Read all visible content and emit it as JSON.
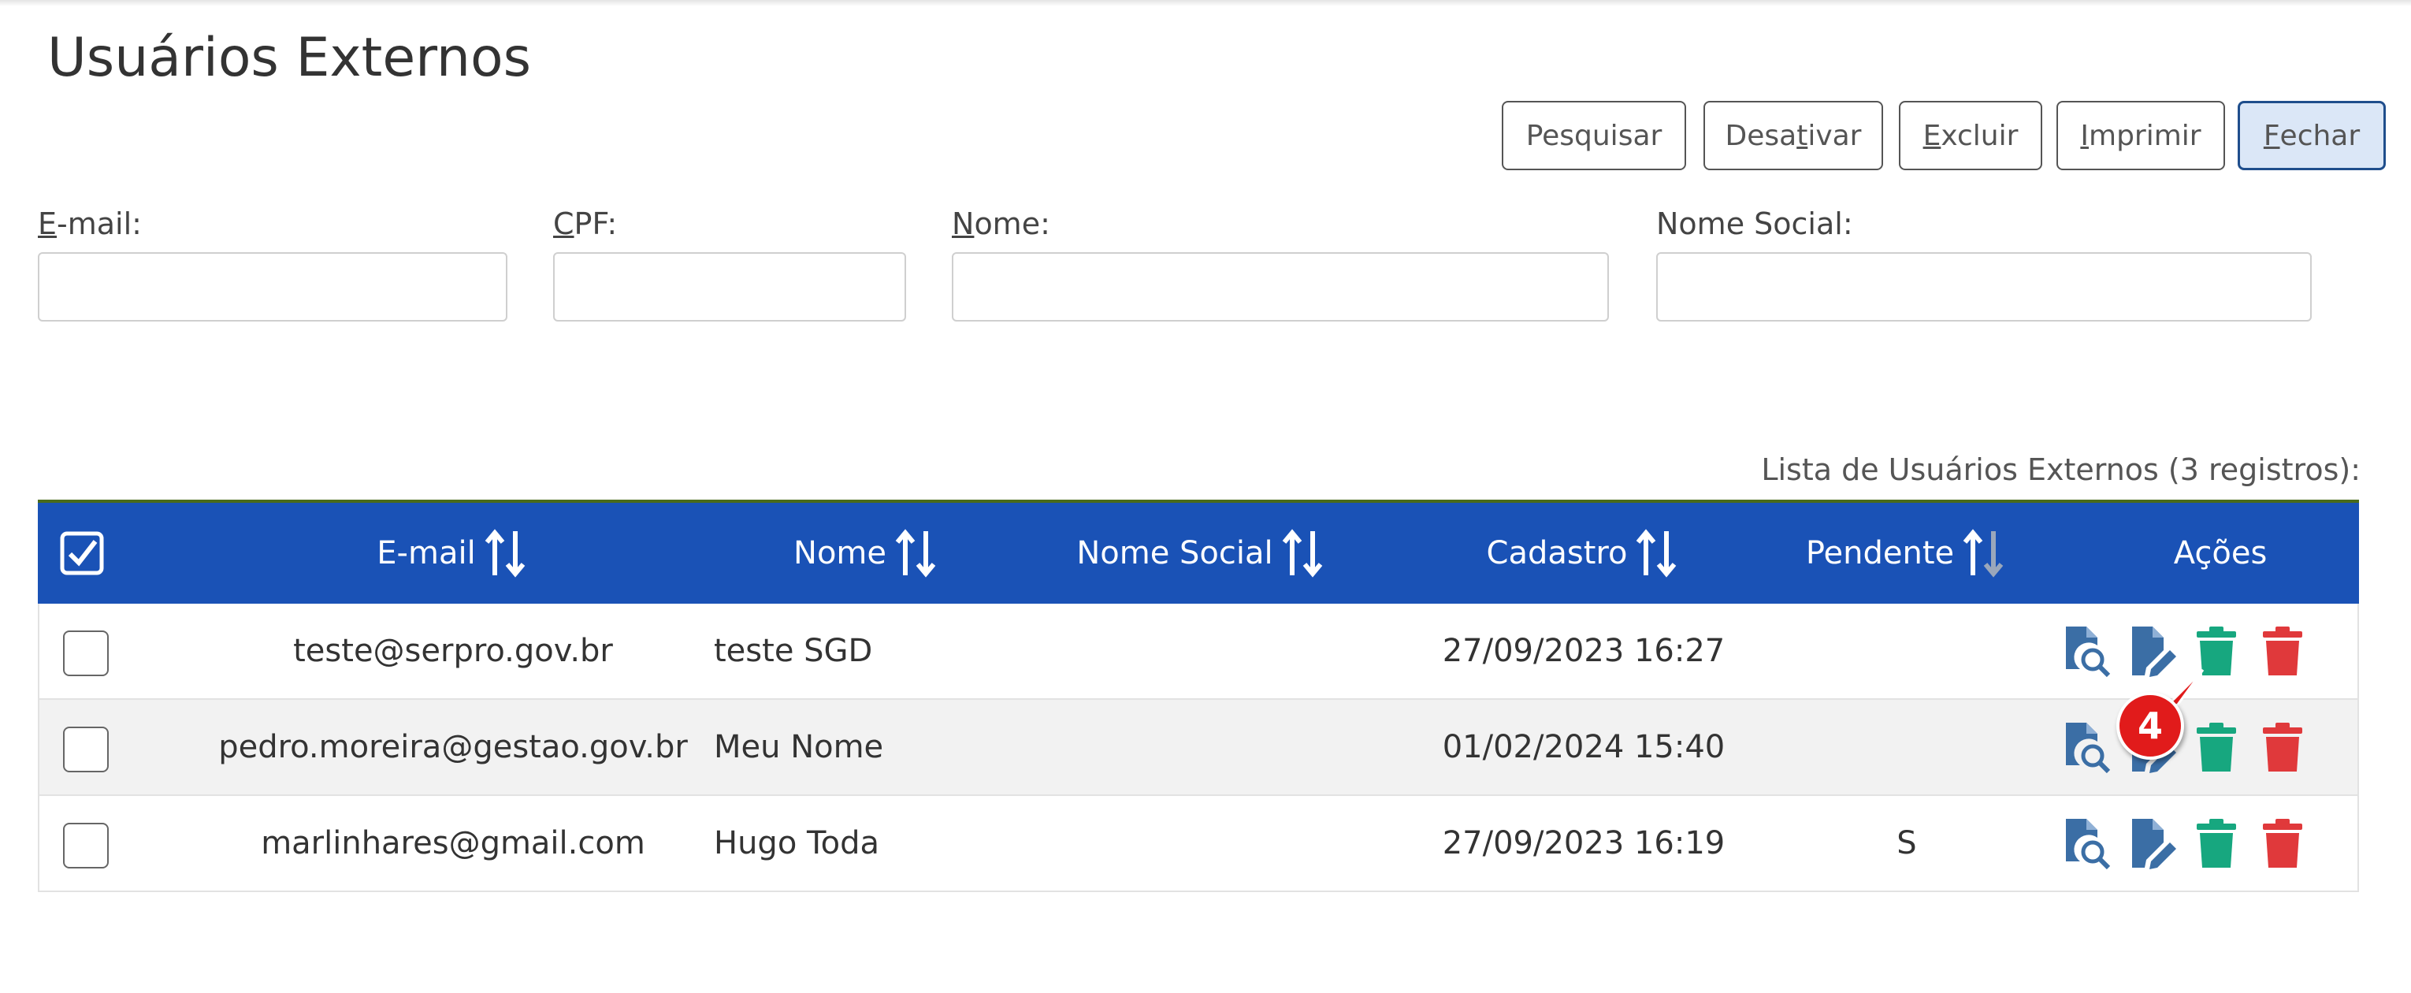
{
  "page": {
    "title": "Usuários Externos"
  },
  "toolbar": {
    "pesquisar": {
      "pre": "Pesquisar",
      "key": "",
      "post": ""
    },
    "desativar": {
      "pre": "Desa",
      "key": "t",
      "post": "ivar"
    },
    "excluir": {
      "pre": "",
      "key": "E",
      "post": "xcluir"
    },
    "imprimir": {
      "pre": "",
      "key": "I",
      "post": "mprimir"
    },
    "fechar": {
      "pre": "",
      "key": "F",
      "post": "echar"
    }
  },
  "filters": {
    "email": {
      "key": "E",
      "rest": "-mail:",
      "value": ""
    },
    "cpf": {
      "key": "C",
      "rest": "PF:",
      "value": ""
    },
    "nome": {
      "key": "N",
      "rest": "ome:",
      "value": ""
    },
    "nome_social": {
      "label": "Nome Social:",
      "value": ""
    }
  },
  "list": {
    "caption": "Lista de Usuários Externos (3 registros):",
    "columns": {
      "email": "E-mail",
      "nome": "Nome",
      "nome_social": "Nome Social",
      "cadastro": "Cadastro",
      "pendente": "Pendente",
      "acoes": "Ações"
    },
    "rows": [
      {
        "email": "teste@serpro.gov.br",
        "nome": "teste SGD",
        "nome_social": "",
        "cadastro": "27/09/2023 16:27",
        "pendente": ""
      },
      {
        "email": "pedro.moreira@gestao.gov.br",
        "nome": "Meu Nome",
        "nome_social": "",
        "cadastro": "01/02/2024 15:40",
        "pendente": ""
      },
      {
        "email": "marlinhares@gmail.com",
        "nome": "Hugo Toda",
        "nome_social": "",
        "cadastro": "27/09/2023 16:19",
        "pendente": "S"
      }
    ]
  },
  "annotation": {
    "badge": "4"
  },
  "colors": {
    "header_bg": "#1a52b6",
    "view_icon": "#3b6ea5",
    "edit_icon": "#3b6ea5",
    "deactivate_icon": "#17a77f",
    "delete_icon": "#e0393b",
    "badge": "#e11b1b"
  },
  "icons": {
    "select_all": "check-square-icon",
    "sort": "sort-arrows-icon",
    "view": "search-document-icon",
    "edit": "edit-document-icon",
    "deactivate": "trash-green-icon",
    "delete": "trash-red-icon"
  }
}
